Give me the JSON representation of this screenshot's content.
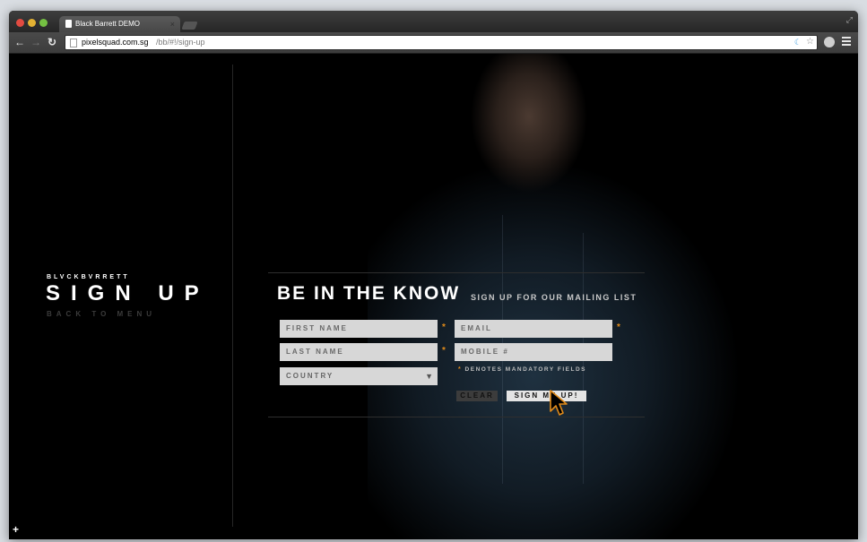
{
  "browser": {
    "tab_title": "Black Barrett DEMO",
    "tab_close": "×",
    "url_host": "pixelsquad.com.sg",
    "url_path": "/bb/#!/sign-up",
    "icons": [
      "back-icon",
      "forward-icon",
      "reload-icon",
      "page-icon",
      "moon-icon",
      "star-icon",
      "extension-icon",
      "menu-icon"
    ]
  },
  "sidebar": {
    "brand": "BLVCKBVRRETT",
    "title": "SIGN UP",
    "back_link": "BACK TO MENU"
  },
  "form": {
    "heading": "BE IN THE KNOW",
    "subheading": "SIGN UP FOR OUR MAILING LIST",
    "first_name_placeholder": "FIRST NAME",
    "last_name_placeholder": "LAST NAME",
    "email_placeholder": "EMAIL",
    "mobile_placeholder": "MOBILE #",
    "country_selected": "COUNTRY",
    "required_marker": "*",
    "mandatory_note": "DENOTES MANDATORY FIELDS",
    "clear_label": "CLEAR",
    "signup_label": "SIGN ME UP!"
  },
  "footer": {
    "plus": "+"
  },
  "colors": {
    "accent": "#e08a1a",
    "field_bg": "#d7d7d7",
    "page_bg": "#000000"
  }
}
